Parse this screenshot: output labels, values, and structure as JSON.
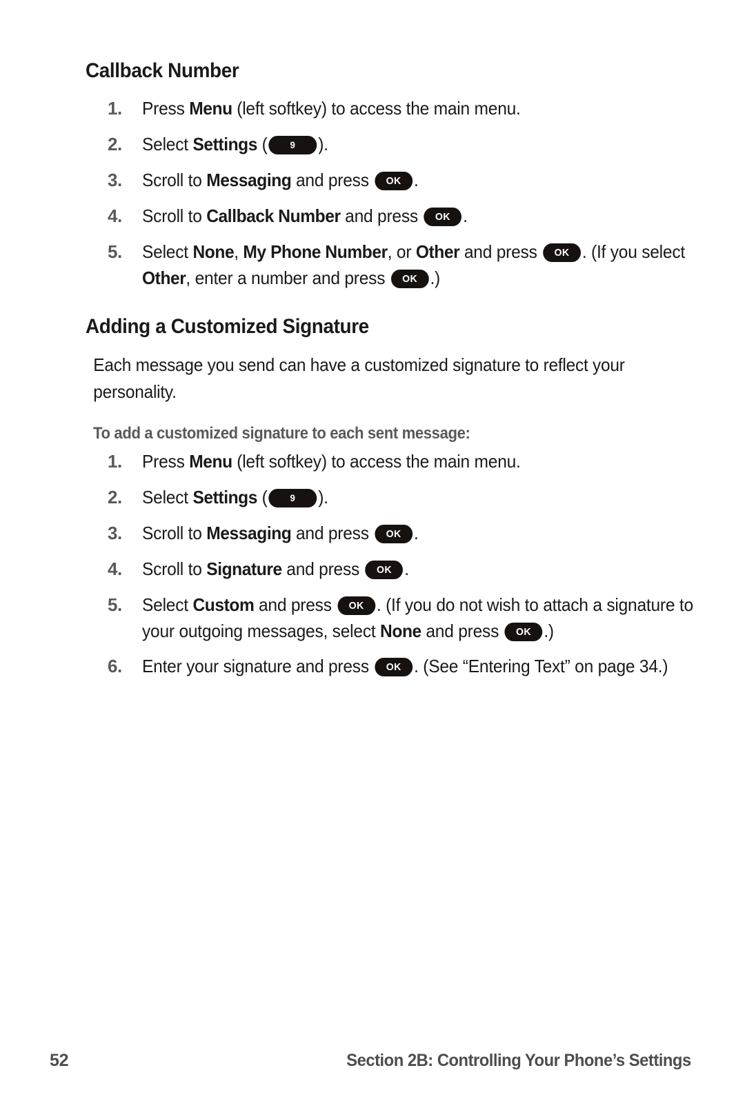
{
  "document": {
    "sections": [
      {
        "heading": "Callback Number",
        "steps": [
          {
            "number": "1.",
            "parts": [
              {
                "t": "text",
                "v": "Press "
              },
              {
                "t": "bold",
                "v": "Menu"
              },
              {
                "t": "text",
                "v": " (left softkey) to access the main menu."
              }
            ]
          },
          {
            "number": "2.",
            "parts": [
              {
                "t": "text",
                "v": "Select "
              },
              {
                "t": "bold",
                "v": "Settings"
              },
              {
                "t": "text",
                "v": " ("
              },
              {
                "t": "key",
                "v": "9",
                "style": "num9"
              },
              {
                "t": "text",
                "v": ")."
              }
            ]
          },
          {
            "number": "3.",
            "parts": [
              {
                "t": "text",
                "v": "Scroll to "
              },
              {
                "t": "bold",
                "v": "Messaging"
              },
              {
                "t": "text",
                "v": " and press "
              },
              {
                "t": "key",
                "v": "OK",
                "style": "ok"
              },
              {
                "t": "text",
                "v": "."
              }
            ]
          },
          {
            "number": "4.",
            "parts": [
              {
                "t": "text",
                "v": "Scroll to "
              },
              {
                "t": "bold",
                "v": "Callback Number"
              },
              {
                "t": "text",
                "v": " and press "
              },
              {
                "t": "key",
                "v": "OK",
                "style": "ok"
              },
              {
                "t": "text",
                "v": "."
              }
            ]
          },
          {
            "number": "5.",
            "parts": [
              {
                "t": "text",
                "v": "Select "
              },
              {
                "t": "bold",
                "v": "None"
              },
              {
                "t": "text",
                "v": ", "
              },
              {
                "t": "bold",
                "v": "My Phone Number"
              },
              {
                "t": "text",
                "v": ", or "
              },
              {
                "t": "bold",
                "v": "Other"
              },
              {
                "t": "text",
                "v": " and press "
              },
              {
                "t": "key",
                "v": "OK",
                "style": "ok"
              },
              {
                "t": "text",
                "v": ". (If you select "
              },
              {
                "t": "bold",
                "v": "Other"
              },
              {
                "t": "text",
                "v": ", enter a number and press "
              },
              {
                "t": "key",
                "v": "OK",
                "style": "ok"
              },
              {
                "t": "text",
                "v": ".)"
              }
            ]
          }
        ]
      },
      {
        "heading": "Adding a Customized Signature",
        "paragraph": "Each message you send can have a customized signature to reflect your personality.",
        "lead": "To add a customized signature to each sent message:",
        "steps": [
          {
            "number": "1.",
            "parts": [
              {
                "t": "text",
                "v": "Press "
              },
              {
                "t": "bold",
                "v": "Menu"
              },
              {
                "t": "text",
                "v": " (left softkey) to access the main menu."
              }
            ]
          },
          {
            "number": "2.",
            "parts": [
              {
                "t": "text",
                "v": "Select "
              },
              {
                "t": "bold",
                "v": "Settings"
              },
              {
                "t": "text",
                "v": " ("
              },
              {
                "t": "key",
                "v": "9",
                "style": "num9"
              },
              {
                "t": "text",
                "v": ")."
              }
            ]
          },
          {
            "number": "3.",
            "parts": [
              {
                "t": "text",
                "v": "Scroll to "
              },
              {
                "t": "bold",
                "v": "Messaging"
              },
              {
                "t": "text",
                "v": " and press "
              },
              {
                "t": "key",
                "v": "OK",
                "style": "ok"
              },
              {
                "t": "text",
                "v": "."
              }
            ]
          },
          {
            "number": "4.",
            "parts": [
              {
                "t": "text",
                "v": "Scroll to "
              },
              {
                "t": "bold",
                "v": "Signature"
              },
              {
                "t": "text",
                "v": " and press "
              },
              {
                "t": "key",
                "v": "OK",
                "style": "ok"
              },
              {
                "t": "text",
                "v": "."
              }
            ]
          },
          {
            "number": "5.",
            "parts": [
              {
                "t": "text",
                "v": "Select "
              },
              {
                "t": "bold",
                "v": "Custom"
              },
              {
                "t": "text",
                "v": " and press "
              },
              {
                "t": "key",
                "v": "OK",
                "style": "ok"
              },
              {
                "t": "text",
                "v": ". (If you do not wish to attach a signature to your outgoing messages, select "
              },
              {
                "t": "bold",
                "v": "None"
              },
              {
                "t": "text",
                "v": " and press "
              },
              {
                "t": "key",
                "v": "OK",
                "style": "ok"
              },
              {
                "t": "text",
                "v": ".)"
              }
            ]
          },
          {
            "number": "6.",
            "parts": [
              {
                "t": "text",
                "v": "Enter your signature and press "
              },
              {
                "t": "key",
                "v": "OK",
                "style": "ok"
              },
              {
                "t": "text",
                "v": ". (See “Entering Text” on page 34.)"
              }
            ]
          }
        ]
      }
    ]
  },
  "footer": {
    "page_number": "52",
    "title": "Section 2B: Controlling Your Phone’s Settings"
  },
  "colors": {
    "body_text": "#1a1a1a",
    "muted_text": "#595959",
    "footer_text": "#4d4d4d",
    "key_fill": "#17120f",
    "key_label": "#ffffff",
    "page_background": "#ffffff"
  }
}
